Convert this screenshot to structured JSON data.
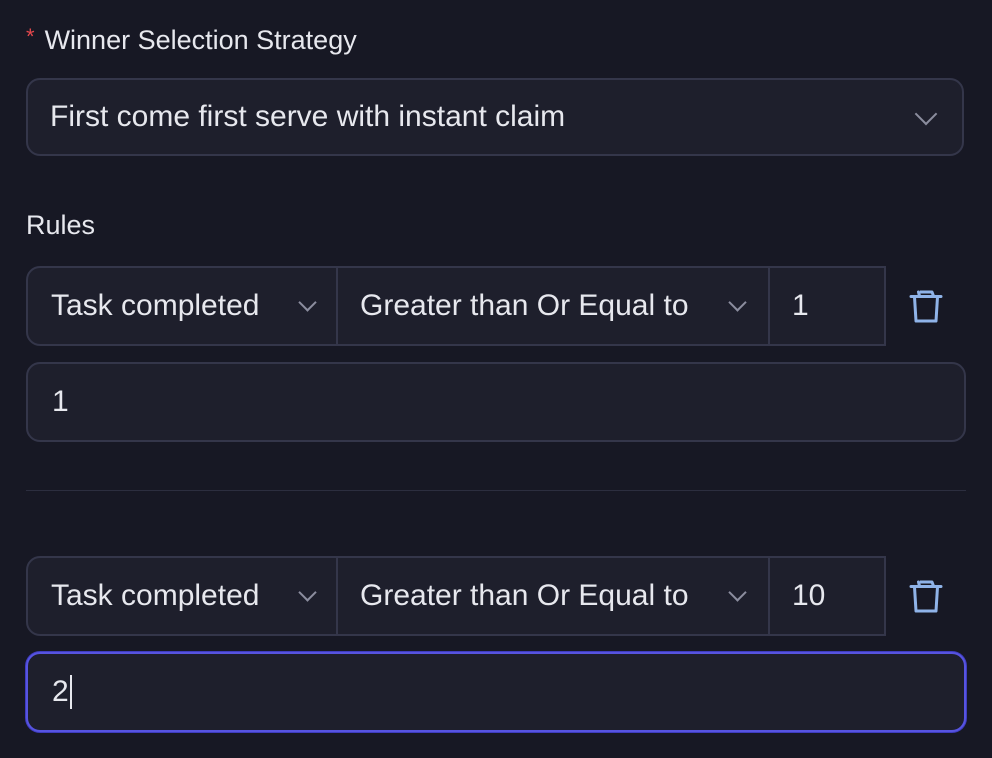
{
  "strategy": {
    "required_mark": "*",
    "label": "Winner Selection Strategy",
    "selected": "First come first serve with instant claim"
  },
  "rules": {
    "label": "Rules",
    "items": [
      {
        "metric": "Task completed",
        "operator": "Greater than Or Equal to",
        "value": "1",
        "detail_value": "1"
      },
      {
        "metric": "Task completed",
        "operator": "Greater than Or Equal to",
        "value": "10",
        "detail_value": "2"
      }
    ]
  },
  "icons": {
    "select_chevron": "chevron-down-icon",
    "delete": "trash-icon"
  },
  "colors": {
    "background": "#171824",
    "field": "#1e1f2c",
    "border": "#34364a",
    "focus": "#5754e0",
    "required": "#e5484d",
    "trash": "#8fb3e8"
  }
}
